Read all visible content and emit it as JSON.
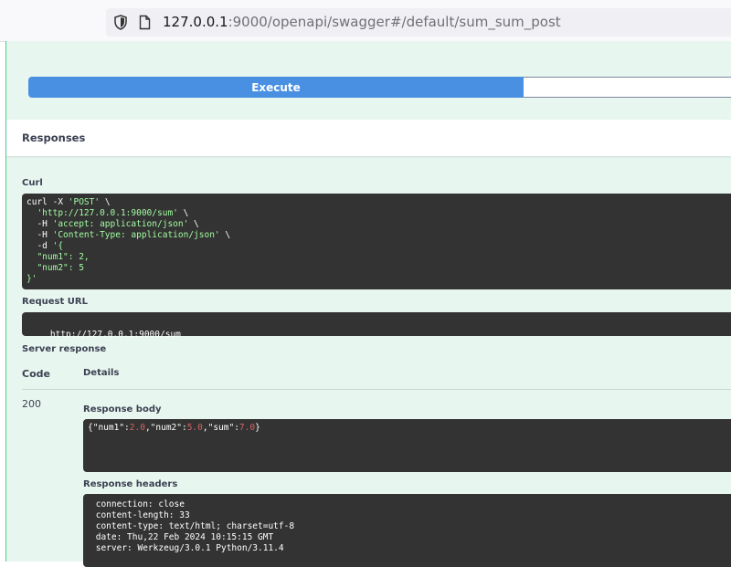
{
  "browser": {
    "url_host": "127.0.0.1",
    "url_rest": ":9000/openapi/swagger#/default/sum_sum_post"
  },
  "actions": {
    "execute_label": "Execute"
  },
  "responses": {
    "title": "Responses",
    "curl_label": "Curl",
    "curl_lines": [
      {
        "pre": "curl -X ",
        "str": "'POST'",
        "post": " \\"
      },
      {
        "pre": "  ",
        "str": "'http://127.0.0.1:9000/sum'",
        "post": " \\"
      },
      {
        "pre": "  -H ",
        "str": "'accept: application/json'",
        "post": " \\"
      },
      {
        "pre": "  -H ",
        "str": "'Content-Type: application/json'",
        "post": " \\"
      },
      {
        "pre": "  -d ",
        "str": "'{",
        "post": ""
      },
      {
        "pre": "",
        "str": "  \"num1\": 2,",
        "post": ""
      },
      {
        "pre": "",
        "str": "  \"num2\": 5",
        "post": ""
      },
      {
        "pre": "",
        "str": "}'",
        "post": ""
      }
    ],
    "request_url_label": "Request URL",
    "request_url": "http://127.0.0.1:9000/sum",
    "server_response_label": "Server response",
    "code_header": "Code",
    "details_header": "Details",
    "status_code": "200",
    "response_body_label": "Response body",
    "response_body": {
      "p1": "{\"num1\":",
      "v1": "2.0",
      "p2": ",\"num2\":",
      "v2": "5.0",
      "p3": ",\"sum\":",
      "v3": "7.0",
      "p4": "}"
    },
    "response_headers_label": "Response headers",
    "response_headers": [
      " connection: close",
      " content-length: 33",
      " content-type: text/html; charset=utf-8",
      " date: Thu,22 Feb 2024 10:15:15 GMT",
      " server: Werkzeug/3.0.1 Python/3.11.4"
    ]
  },
  "colors": {
    "panel_bg": "#e8f6f0",
    "execute_blue": "#4990e2",
    "code_bg": "#333333",
    "string_green": "#a2fca2",
    "number_red": "#d36363"
  }
}
